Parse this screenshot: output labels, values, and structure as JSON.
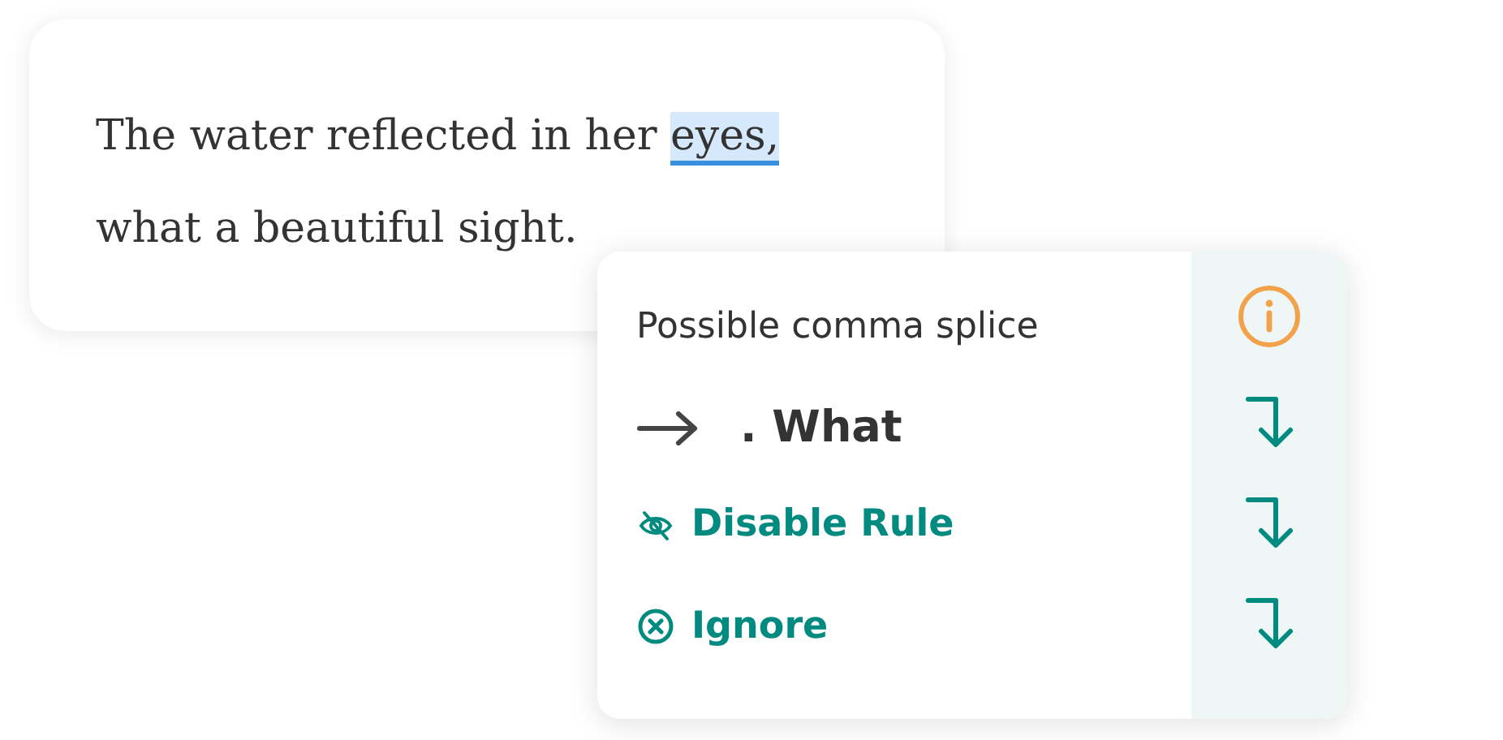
{
  "editor": {
    "text_before": "The water reflected in her ",
    "highlight": "eyes,",
    "text_after": "what a beautiful sight."
  },
  "popup": {
    "title": "Possible comma splice",
    "suggestion": ". What",
    "actions": [
      {
        "kind": "disable",
        "label": "Disable Rule"
      },
      {
        "kind": "ignore",
        "label": "Ignore"
      }
    ]
  }
}
